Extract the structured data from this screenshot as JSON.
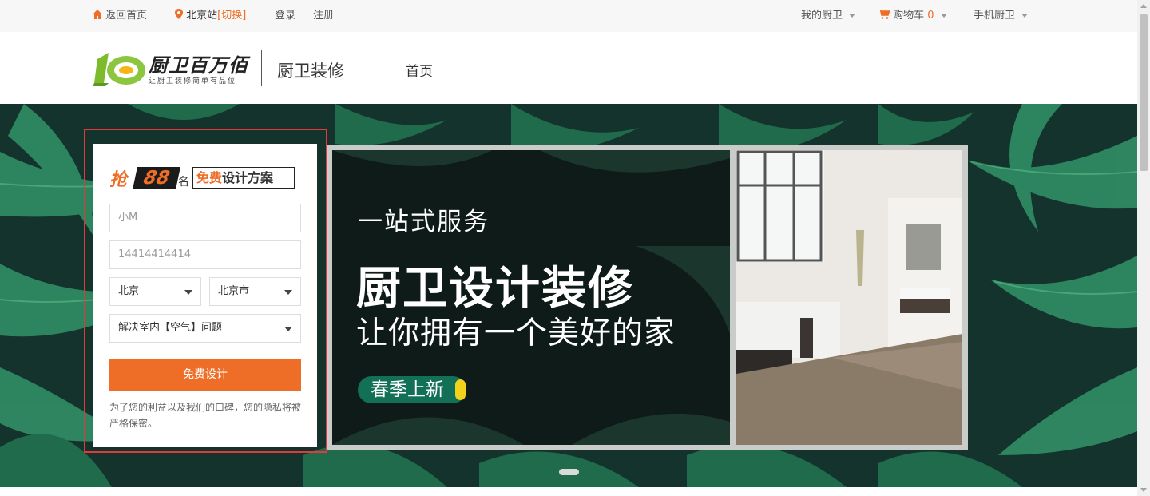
{
  "topbar": {
    "home_label": "返回首页",
    "city_label": "北京站",
    "switch_label": "[切换]",
    "login_label": "登录",
    "register_label": "注册",
    "my_label": "我的厨卫",
    "cart_label": "购物车",
    "cart_count": "0",
    "mobile_label": "手机厨卫"
  },
  "header": {
    "logo_text": "厨卫百万佰",
    "logo_slogan": "让厨卫装修简单有品位",
    "site_name": "厨卫装修",
    "nav_home": "首页"
  },
  "form": {
    "promo_qiang": "抢",
    "promo_number": "88",
    "promo_ming": "名",
    "promo_free": "免费",
    "promo_rest": "设计方案",
    "name_placeholder": "小M",
    "phone_placeholder": "14414414414",
    "province": "北京",
    "city": "北京市",
    "issue": "解决室内【空气】问题",
    "submit_label": "免费设计",
    "note": "为了您的利益以及我们的口碑，您的隐私将被严格保密。"
  },
  "banner": {
    "line1": "一站式服务",
    "line2": "厨卫设计装修",
    "line3": "让你拥有一个美好的家",
    "tag": "春季上新"
  },
  "colors": {
    "accent": "#ee6d27",
    "outline": "#e4393c",
    "tag_green": "#127056"
  },
  "icons": [
    "home-icon",
    "location-pin-icon",
    "cart-icon",
    "chevron-down-icon"
  ]
}
